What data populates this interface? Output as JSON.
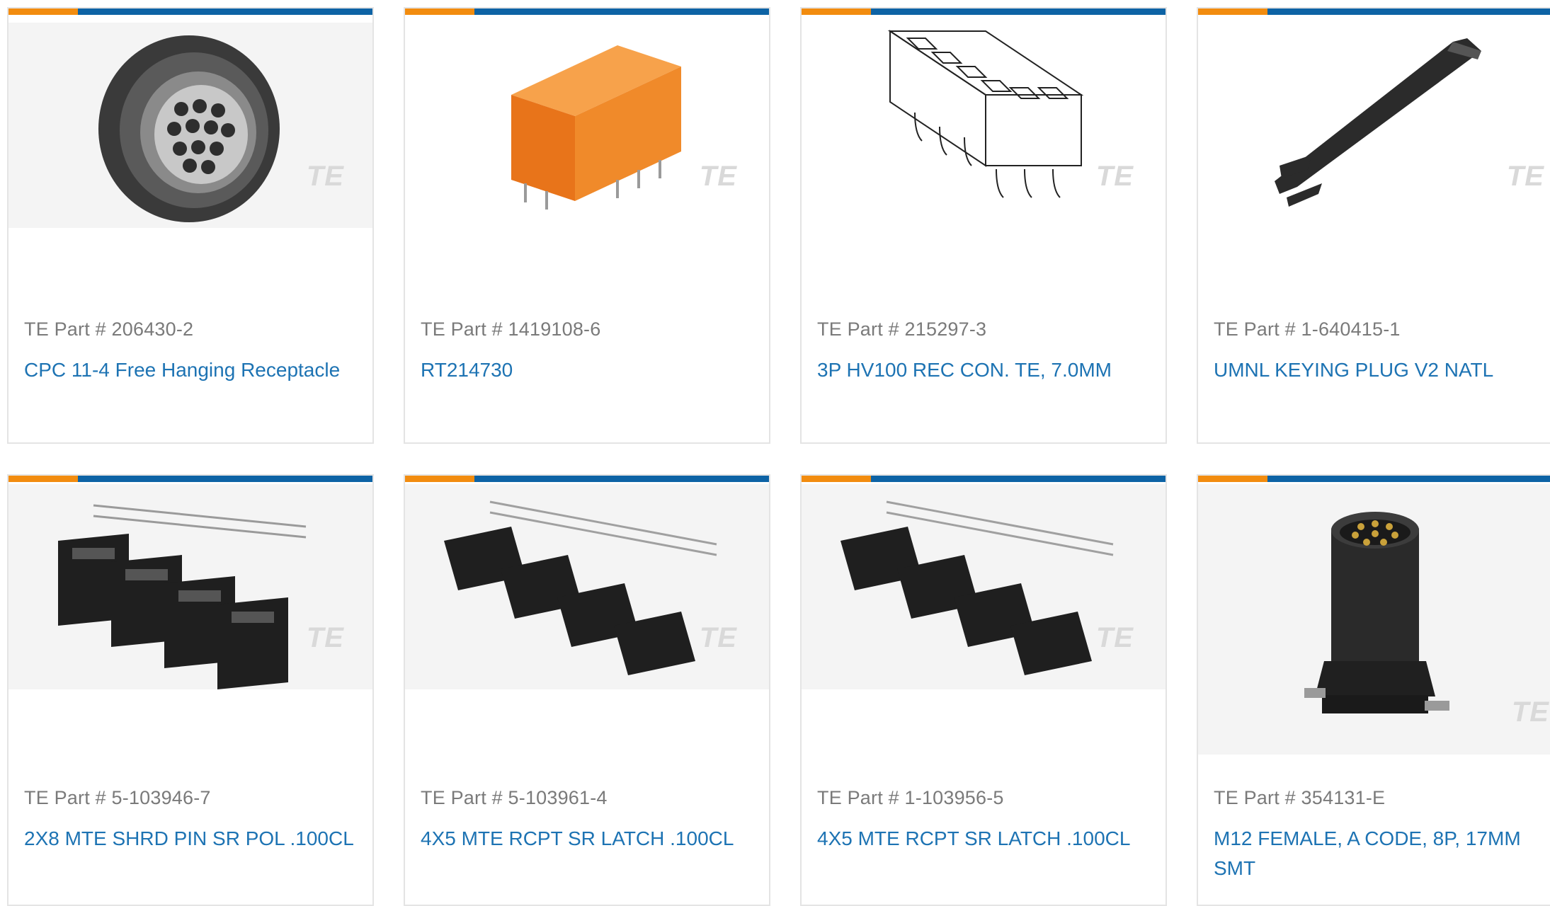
{
  "colors": {
    "accent_orange": "#f28c0f",
    "accent_blue": "#0d63a5",
    "link_blue": "#1d73b3",
    "part_gray": "#7a7a7a",
    "border": "#e4e4e4"
  },
  "products": [
    {
      "part_label": "TE Part # 206430-2",
      "title": "CPC 11-4 Free Hanging Receptacle",
      "image_icon": "circular-connector-icon",
      "logo": "TE"
    },
    {
      "part_label": "TE Part # 1419108-6",
      "title": "RT214730",
      "image_icon": "relay-icon",
      "logo": "TE"
    },
    {
      "part_label": "TE Part # 215297-3",
      "title": "3P HV100 REC CON. TE, 7.0MM",
      "image_icon": "header-connector-icon",
      "logo": "TE"
    },
    {
      "part_label": "TE Part # 1-640415-1",
      "title": "UMNL KEYING PLUG V2 NATL",
      "image_icon": "keying-plug-icon",
      "logo": "TE"
    },
    {
      "part_label": "TE Part # 5-103946-7",
      "title": "2X8 MTE SHRD PIN SR POL .100CL",
      "image_icon": "mte-connector-strip-icon",
      "logo": "TE"
    },
    {
      "part_label": "TE Part # 5-103961-4",
      "title": "4X5 MTE RCPT SR LATCH .100CL",
      "image_icon": "mte-receptacle-strip-icon",
      "logo": "TE"
    },
    {
      "part_label": "TE Part # 1-103956-5",
      "title": "4X5 MTE RCPT SR LATCH .100CL",
      "image_icon": "mte-receptacle-strip-icon",
      "logo": "TE"
    },
    {
      "part_label": "TE Part # 354131-E",
      "title": "M12 FEMALE, A CODE, 8P, 17MM SMT",
      "image_icon": "m12-connector-icon",
      "logo": "TE"
    }
  ]
}
